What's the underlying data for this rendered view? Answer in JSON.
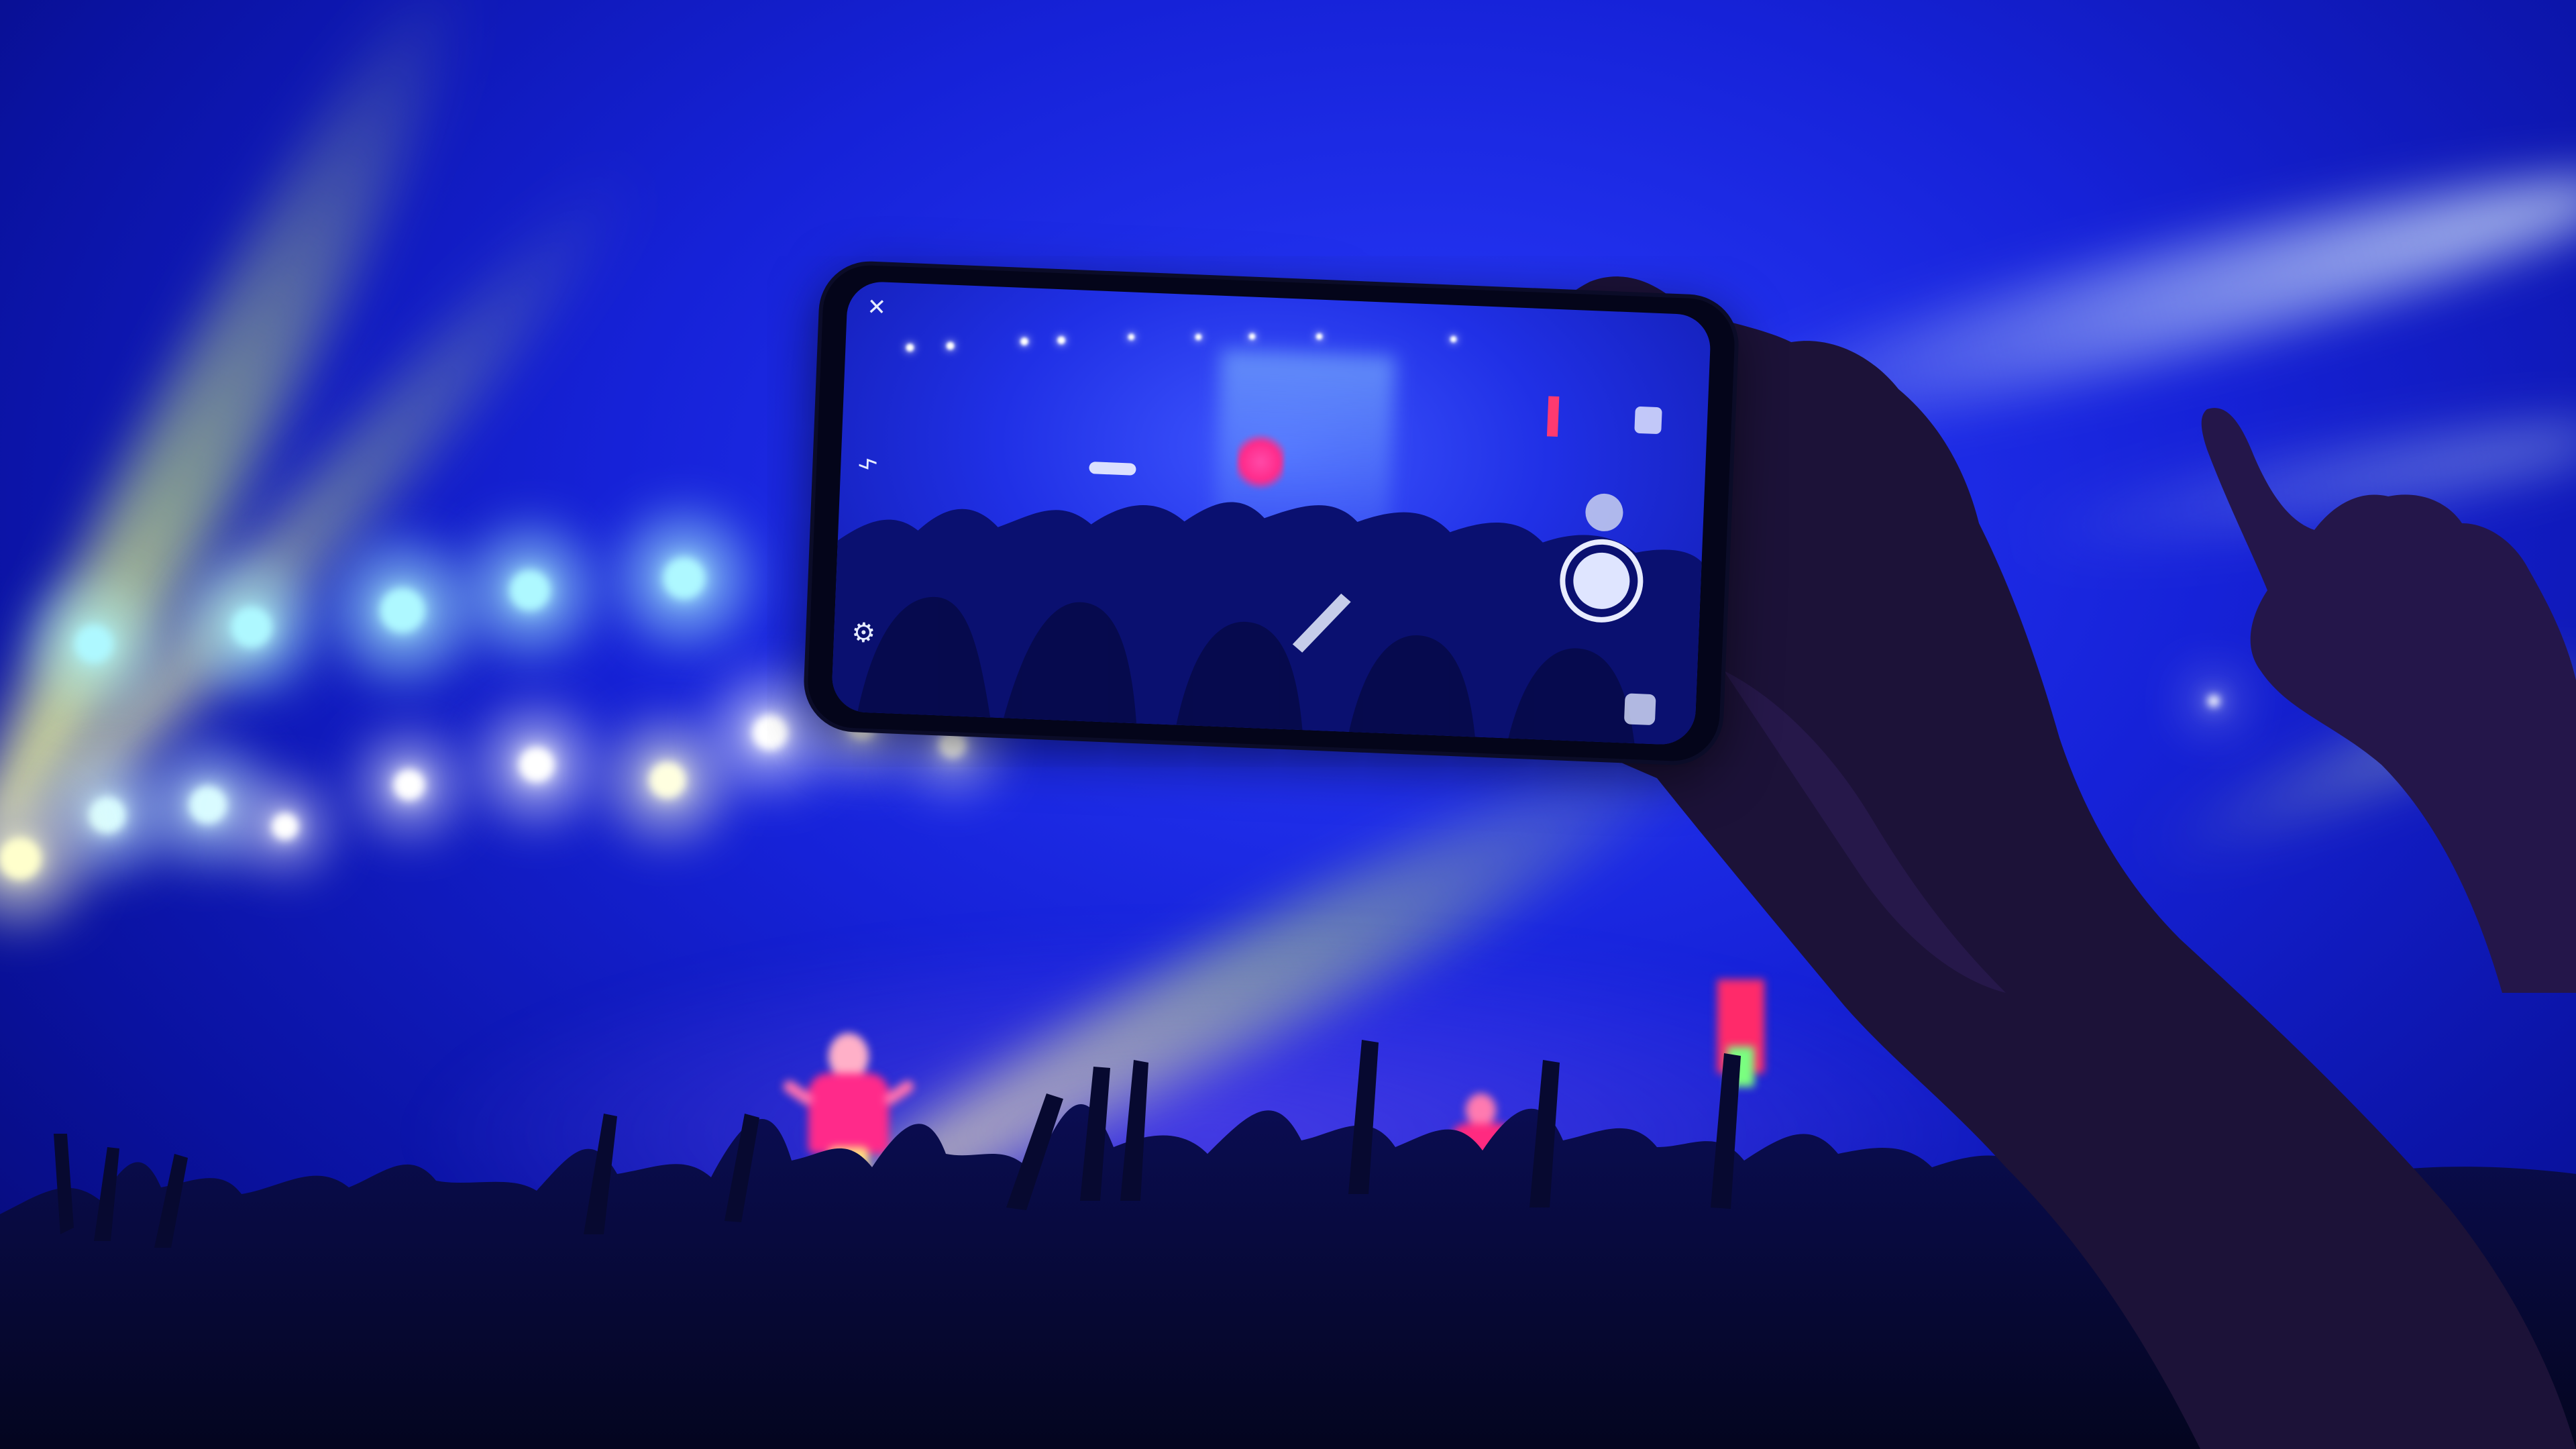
{
  "scene": {
    "description_colors": {
      "background": "#1622d8",
      "beam": "#e8ff70",
      "spot_cyan": "#7ff6ff",
      "spot_white": "#ffffff",
      "performer": "#ff3aa0",
      "crowd": "#070930",
      "hand": "#1a0f35"
    }
  },
  "phone_ui": {
    "close_icon": "close-icon",
    "flash_icon": "flash-off-icon",
    "settings_icon": "gear-icon",
    "switch_camera_icon": "camera-switch-icon",
    "gallery_icon": "gallery-thumbnail-icon",
    "shutter_icon": "shutter-button-icon",
    "close_glyph": "✕",
    "settings_glyph": "⚙",
    "flash_glyph": "ϟ"
  }
}
